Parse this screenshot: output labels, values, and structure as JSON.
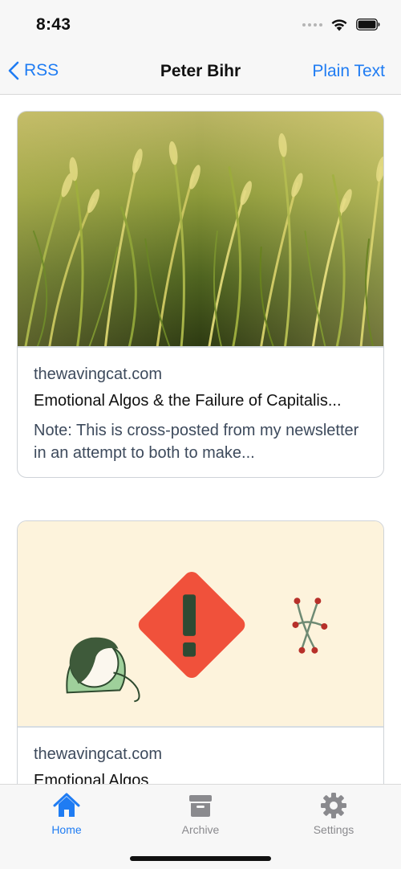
{
  "status_bar": {
    "time": "8:43",
    "icons": [
      "signal-icon",
      "wifi-icon",
      "battery-icon"
    ]
  },
  "nav": {
    "back_label": "RSS",
    "title": "Peter Bihr",
    "right_label": "Plain Text"
  },
  "feed": {
    "items": [
      {
        "domain": "thewavingcat.com",
        "title": "Emotional Algos & the Failure of Capitalis...",
        "summary": "Note: This is cross-posted from my newsletter in an attempt to both to make...",
        "image": "wheat-field-photo"
      },
      {
        "domain": "thewavingcat.com",
        "title": "Emotional Algos",
        "summary": "",
        "image": "illustration-person-warning-sign"
      }
    ]
  },
  "tab_bar": {
    "tabs": [
      {
        "label": "Home",
        "icon": "house-icon",
        "active": true
      },
      {
        "label": "Archive",
        "icon": "archive-box-icon",
        "active": false
      },
      {
        "label": "Settings",
        "icon": "gear-icon",
        "active": false
      }
    ]
  },
  "colors": {
    "accent": "#1f7cf3",
    "secondary_text": "#3d4a5c",
    "bar_background": "#f7f7f7",
    "illustration_bg": "#fdf3dc",
    "warning_red": "#f0513b"
  }
}
